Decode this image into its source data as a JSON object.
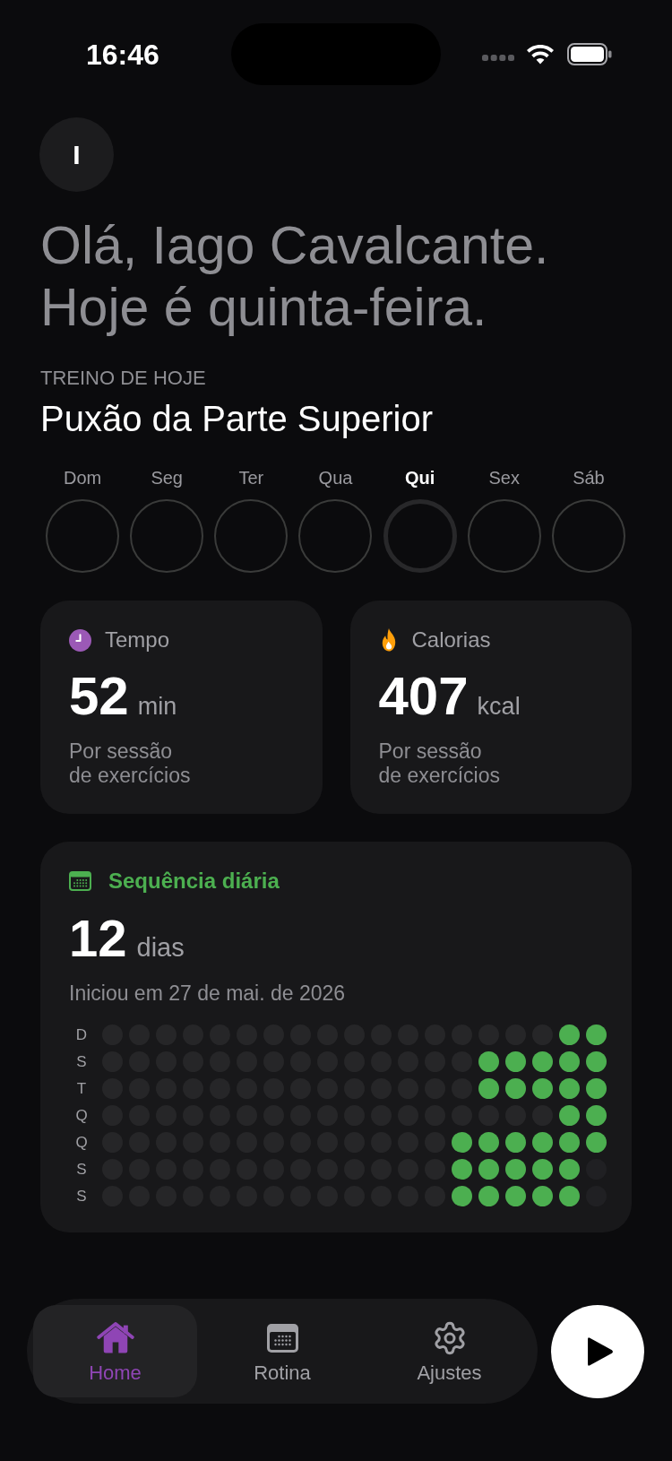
{
  "status_bar": {
    "time": "16:46"
  },
  "profile": {
    "initial": "I",
    "greeting": "Olá, Iago Cavalcante.\nHoje é quinta-feira."
  },
  "today_workout": {
    "label": "TREINO DE HOJE",
    "name": "Puxão da Parte Superior"
  },
  "week": [
    {
      "label": "Dom",
      "selected": false
    },
    {
      "label": "Seg",
      "selected": false
    },
    {
      "label": "Ter",
      "selected": false
    },
    {
      "label": "Qua",
      "selected": false
    },
    {
      "label": "Qui",
      "selected": true
    },
    {
      "label": "Sex",
      "selected": false
    },
    {
      "label": "Sáb",
      "selected": false
    }
  ],
  "stats": [
    {
      "kind": "time",
      "label": "Tempo",
      "value": "52",
      "unit": "min",
      "caption": "Por sessão\nde exercícios"
    },
    {
      "kind": "calories",
      "label": "Calorias",
      "value": "407",
      "unit": "kcal",
      "caption": "Por sessão\nde exercícios"
    }
  ],
  "streak": {
    "title": "Sequência diária",
    "value": "12",
    "unit": "dias",
    "started": "Iniciou em 27 de mai. de 2026",
    "rows": [
      {
        "label": "D",
        "cells": [
          {
            "kind": "missed"
          },
          {
            "kind": "missed"
          },
          {
            "kind": "missed"
          },
          {
            "kind": "missed"
          },
          {
            "kind": "missed"
          },
          {
            "kind": "missed"
          },
          {
            "kind": "missed"
          },
          {
            "kind": "missed"
          },
          {
            "kind": "missed"
          },
          {
            "kind": "missed"
          },
          {
            "kind": "missed"
          },
          {
            "kind": "missed"
          },
          {
            "kind": "missed"
          },
          {
            "kind": "missed"
          },
          {
            "kind": "missed"
          },
          {
            "kind": "missed"
          },
          {
            "kind": "missed"
          },
          {
            "kind": "done"
          },
          {
            "kind": "done"
          }
        ]
      },
      {
        "label": "S",
        "cells": [
          {
            "kind": "missed"
          },
          {
            "kind": "missed"
          },
          {
            "kind": "missed"
          },
          {
            "kind": "missed"
          },
          {
            "kind": "missed"
          },
          {
            "kind": "missed"
          },
          {
            "kind": "missed"
          },
          {
            "kind": "missed"
          },
          {
            "kind": "missed"
          },
          {
            "kind": "missed"
          },
          {
            "kind": "missed"
          },
          {
            "kind": "missed"
          },
          {
            "kind": "missed"
          },
          {
            "kind": "missed"
          },
          {
            "kind": "done"
          },
          {
            "kind": "done"
          },
          {
            "kind": "done"
          },
          {
            "kind": "done"
          },
          {
            "kind": "done"
          }
        ]
      },
      {
        "label": "T",
        "cells": [
          {
            "kind": "missed"
          },
          {
            "kind": "missed"
          },
          {
            "kind": "missed"
          },
          {
            "kind": "missed"
          },
          {
            "kind": "missed"
          },
          {
            "kind": "missed"
          },
          {
            "kind": "missed"
          },
          {
            "kind": "missed"
          },
          {
            "kind": "missed"
          },
          {
            "kind": "missed"
          },
          {
            "kind": "missed"
          },
          {
            "kind": "missed"
          },
          {
            "kind": "missed"
          },
          {
            "kind": "missed"
          },
          {
            "kind": "done"
          },
          {
            "kind": "done"
          },
          {
            "kind": "done"
          },
          {
            "kind": "done"
          },
          {
            "kind": "done"
          }
        ]
      },
      {
        "label": "Q",
        "cells": [
          {
            "kind": "missed"
          },
          {
            "kind": "missed"
          },
          {
            "kind": "missed"
          },
          {
            "kind": "missed"
          },
          {
            "kind": "missed"
          },
          {
            "kind": "missed"
          },
          {
            "kind": "missed"
          },
          {
            "kind": "missed"
          },
          {
            "kind": "missed"
          },
          {
            "kind": "missed"
          },
          {
            "kind": "missed"
          },
          {
            "kind": "missed"
          },
          {
            "kind": "missed"
          },
          {
            "kind": "missed"
          },
          {
            "kind": "missed"
          },
          {
            "kind": "missed"
          },
          {
            "kind": "missed"
          },
          {
            "kind": "done"
          },
          {
            "kind": "done"
          }
        ]
      },
      {
        "label": "Q",
        "cells": [
          {
            "kind": "missed"
          },
          {
            "kind": "missed"
          },
          {
            "kind": "missed"
          },
          {
            "kind": "missed"
          },
          {
            "kind": "missed"
          },
          {
            "kind": "missed"
          },
          {
            "kind": "missed"
          },
          {
            "kind": "missed"
          },
          {
            "kind": "missed"
          },
          {
            "kind": "missed"
          },
          {
            "kind": "missed"
          },
          {
            "kind": "missed"
          },
          {
            "kind": "missed"
          },
          {
            "kind": "done"
          },
          {
            "kind": "done"
          },
          {
            "kind": "done"
          },
          {
            "kind": "done"
          },
          {
            "kind": "done"
          },
          {
            "kind": "done"
          }
        ]
      },
      {
        "label": "S",
        "cells": [
          {
            "kind": "missed"
          },
          {
            "kind": "missed"
          },
          {
            "kind": "missed"
          },
          {
            "kind": "missed"
          },
          {
            "kind": "missed"
          },
          {
            "kind": "missed"
          },
          {
            "kind": "missed"
          },
          {
            "kind": "missed"
          },
          {
            "kind": "missed"
          },
          {
            "kind": "missed"
          },
          {
            "kind": "missed"
          },
          {
            "kind": "missed"
          },
          {
            "kind": "missed"
          },
          {
            "kind": "done"
          },
          {
            "kind": "done"
          },
          {
            "kind": "done"
          },
          {
            "kind": "done"
          },
          {
            "kind": "done"
          },
          {
            "kind": "future"
          }
        ]
      },
      {
        "label": "S",
        "cells": [
          {
            "kind": "missed"
          },
          {
            "kind": "missed"
          },
          {
            "kind": "missed"
          },
          {
            "kind": "missed"
          },
          {
            "kind": "missed"
          },
          {
            "kind": "missed"
          },
          {
            "kind": "missed"
          },
          {
            "kind": "missed"
          },
          {
            "kind": "missed"
          },
          {
            "kind": "missed"
          },
          {
            "kind": "missed"
          },
          {
            "kind": "missed"
          },
          {
            "kind": "missed"
          },
          {
            "kind": "done"
          },
          {
            "kind": "done"
          },
          {
            "kind": "done"
          },
          {
            "kind": "done"
          },
          {
            "kind": "done"
          },
          {
            "kind": "future"
          }
        ]
      }
    ]
  },
  "tab_bar": {
    "tabs": [
      {
        "kind": "home",
        "label": "Home",
        "selected": true
      },
      {
        "kind": "routine",
        "label": "Rotina",
        "selected": false
      },
      {
        "kind": "settings",
        "label": "Ajustes",
        "selected": false
      }
    ]
  }
}
